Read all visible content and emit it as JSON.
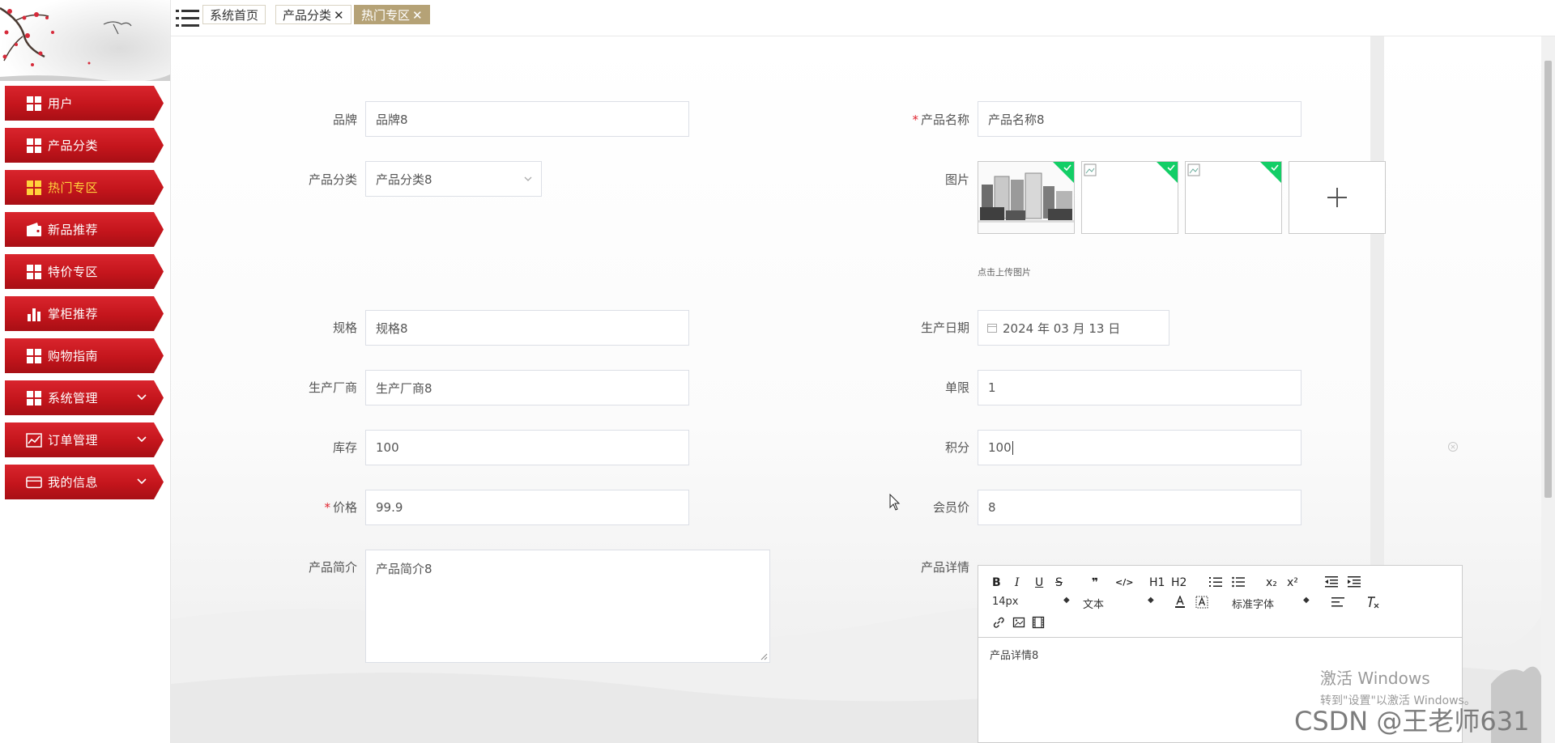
{
  "sidebar": {
    "items": [
      {
        "label": "用户",
        "icon": "grid-icon"
      },
      {
        "label": "产品分类",
        "icon": "grid-icon"
      },
      {
        "label": "热门专区",
        "icon": "grid-icon",
        "active": true
      },
      {
        "label": "新品推荐",
        "icon": "wallet-icon"
      },
      {
        "label": "特价专区",
        "icon": "grid-icon"
      },
      {
        "label": "掌柜推荐",
        "icon": "bar-chart-icon"
      },
      {
        "label": "购物指南",
        "icon": "grid-icon"
      },
      {
        "label": "系统管理",
        "icon": "grid-icon",
        "expandable": true
      },
      {
        "label": "订单管理",
        "icon": "line-chart-icon",
        "expandable": true
      },
      {
        "label": "我的信息",
        "icon": "card-icon",
        "expandable": true
      }
    ]
  },
  "tabs": [
    {
      "label": "系统首页",
      "closable": false
    },
    {
      "label": "产品分类",
      "closable": true
    },
    {
      "label": "热门专区",
      "closable": true,
      "active": true
    }
  ],
  "tab_close_glyph": "✕",
  "form": {
    "brand": {
      "label": "品牌",
      "value": "品牌8"
    },
    "product_name": {
      "label": "产品名称",
      "value": "产品名称8",
      "required": true
    },
    "category": {
      "label": "产品分类",
      "value": "产品分类8"
    },
    "images": {
      "label": "图片",
      "hint": "点击上传图片",
      "count": 3
    },
    "spec": {
      "label": "规格",
      "value": "规格8"
    },
    "production_date": {
      "label": "生产日期",
      "value": "2024 年 03 月 13 日"
    },
    "manufacturer": {
      "label": "生产厂商",
      "value": "生产厂商8"
    },
    "limit": {
      "label": "单限",
      "value": "1"
    },
    "stock": {
      "label": "库存",
      "value": "100"
    },
    "points": {
      "label": "积分",
      "value": "100"
    },
    "price": {
      "label": "价格",
      "value": "99.9",
      "required": true
    },
    "member_price": {
      "label": "会员价",
      "value": "8"
    },
    "summary": {
      "label": "产品简介",
      "value": "产品简介8"
    },
    "details": {
      "label": "产品详情",
      "value": "产品详情8"
    }
  },
  "required_mark": "*",
  "editor": {
    "toolbar": {
      "bold": "B",
      "italic": "I",
      "underline": "U",
      "strike": "S",
      "quote": "❞",
      "code": "</>",
      "h1": "H1",
      "h2": "H2",
      "subscript": "x₂",
      "superscript": "x²",
      "font_size": "14px",
      "block_type": "文本",
      "font_family": "标准字体"
    }
  },
  "watermark": {
    "win_title": "激活 Windows",
    "win_sub": "转到\"设置\"以激活 Windows。",
    "csdn": "CSDN @王老师631"
  },
  "colors": {
    "nav_red": "#c4151c",
    "nav_active_text": "#ffd23c",
    "tab_active": "#b5a276",
    "required": "#e0232e",
    "upload_success": "#13ce66"
  }
}
